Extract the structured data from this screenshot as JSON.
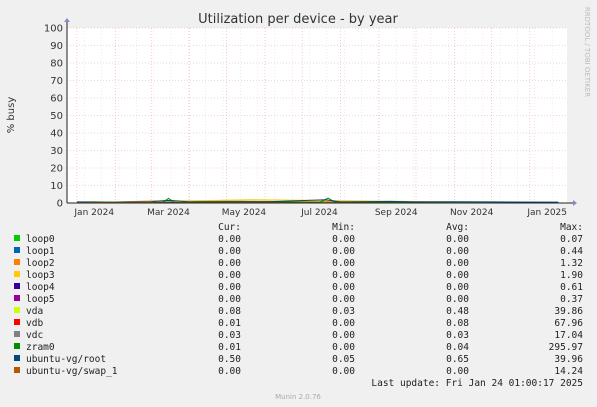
{
  "chart_data": {
    "type": "line",
    "title": "Utilization per device - by year",
    "ylabel": "% busy",
    "ylim": [
      0,
      100
    ],
    "yticks": [
      0,
      10,
      20,
      30,
      40,
      50,
      60,
      70,
      80,
      90,
      100
    ],
    "xlim": [
      "2023-12-24",
      "2025-01-31"
    ],
    "xticks": [
      {
        "label": "Jan 2024",
        "date": "2024-01-15"
      },
      {
        "label": "Mar 2024",
        "date": "2024-03-15"
      },
      {
        "label": "May 2024",
        "date": "2024-05-15"
      },
      {
        "label": "Jul 2024",
        "date": "2024-07-15"
      },
      {
        "label": "Sep 2024",
        "date": "2024-09-15"
      },
      {
        "label": "Nov 2024",
        "date": "2024-11-15"
      },
      {
        "label": "Jan 2025",
        "date": "2025-01-15"
      }
    ],
    "grid": true,
    "watermark": "RRDTOOL / TOBI OETIKER",
    "series": [
      {
        "name": "loop0",
        "color": "#00cc00",
        "values": [
          {
            "x": "2024-01-01",
            "y": 0.0
          },
          {
            "x": "2024-06-01",
            "y": 0.07
          },
          {
            "x": "2025-01-24",
            "y": 0.0
          }
        ]
      },
      {
        "name": "loop1",
        "color": "#0066b3",
        "values": [
          {
            "x": "2024-01-01",
            "y": 0.0
          },
          {
            "x": "2024-06-01",
            "y": 0.44
          },
          {
            "x": "2025-01-24",
            "y": 0.0
          }
        ]
      },
      {
        "name": "loop2",
        "color": "#ff8000",
        "values": [
          {
            "x": "2024-01-01",
            "y": 0.0
          },
          {
            "x": "2024-03-10",
            "y": 1.32
          },
          {
            "x": "2025-01-24",
            "y": 0.0
          }
        ]
      },
      {
        "name": "loop3",
        "color": "#ffcc00",
        "values": [
          {
            "x": "2024-01-01",
            "y": 0.0
          },
          {
            "x": "2024-05-20",
            "y": 1.9
          },
          {
            "x": "2025-01-24",
            "y": 0.0
          }
        ]
      },
      {
        "name": "loop4",
        "color": "#330099",
        "values": [
          {
            "x": "2024-01-01",
            "y": 0.0
          },
          {
            "x": "2024-04-10",
            "y": 0.61
          },
          {
            "x": "2025-01-24",
            "y": 0.0
          }
        ]
      },
      {
        "name": "loop5",
        "color": "#990099",
        "values": [
          {
            "x": "2024-01-01",
            "y": 0.0
          },
          {
            "x": "2024-08-01",
            "y": 0.37
          },
          {
            "x": "2025-01-24",
            "y": 0.0
          }
        ]
      },
      {
        "name": "vda",
        "color": "#ccff00",
        "values": [
          {
            "x": "2024-01-01",
            "y": 0.5
          },
          {
            "x": "2024-01-15",
            "y": 0.8
          },
          {
            "x": "2024-02-01",
            "y": 0.4
          },
          {
            "x": "2024-03-01",
            "y": 0.6
          },
          {
            "x": "2024-03-15",
            "y": 1.2
          },
          {
            "x": "2024-04-01",
            "y": 0.5
          },
          {
            "x": "2024-05-01",
            "y": 0.7
          },
          {
            "x": "2024-06-01",
            "y": 0.5
          },
          {
            "x": "2024-07-01",
            "y": 0.4
          },
          {
            "x": "2024-08-01",
            "y": 0.3
          },
          {
            "x": "2024-09-01",
            "y": 0.4
          },
          {
            "x": "2024-10-01",
            "y": 0.3
          },
          {
            "x": "2024-11-01",
            "y": 0.4
          },
          {
            "x": "2024-12-01",
            "y": 0.3
          },
          {
            "x": "2025-01-24",
            "y": 0.08
          }
        ]
      },
      {
        "name": "vdb",
        "color": "#ff0000",
        "values": [
          {
            "x": "2024-01-01",
            "y": 0.0
          },
          {
            "x": "2024-07-01",
            "y": 0.1
          },
          {
            "x": "2025-01-24",
            "y": 0.01
          }
        ]
      },
      {
        "name": "vdc",
        "color": "#808080",
        "values": [
          {
            "x": "2024-01-01",
            "y": 0.0
          },
          {
            "x": "2024-06-01",
            "y": 0.1
          },
          {
            "x": "2025-01-24",
            "y": 0.03
          }
        ]
      },
      {
        "name": "zram0",
        "color": "#008f00",
        "values": [
          {
            "x": "2024-01-01",
            "y": 0.0
          },
          {
            "x": "2024-03-10",
            "y": 0.2
          },
          {
            "x": "2024-03-15",
            "y": 2.6
          },
          {
            "x": "2024-03-20",
            "y": 0.2
          },
          {
            "x": "2024-05-20",
            "y": 0.8
          },
          {
            "x": "2024-07-15",
            "y": 0.3
          },
          {
            "x": "2024-07-22",
            "y": 2.8
          },
          {
            "x": "2024-07-28",
            "y": 0.2
          },
          {
            "x": "2024-09-10",
            "y": 0.5
          },
          {
            "x": "2024-10-15",
            "y": 0.1
          },
          {
            "x": "2025-01-24",
            "y": 0.01
          }
        ]
      },
      {
        "name": "ubuntu-vg/root",
        "color": "#00487d",
        "values": [
          {
            "x": "2024-01-01",
            "y": 0.6
          },
          {
            "x": "2024-02-01",
            "y": 0.5
          },
          {
            "x": "2024-03-01",
            "y": 0.7
          },
          {
            "x": "2024-03-15",
            "y": 1.5
          },
          {
            "x": "2024-04-01",
            "y": 0.6
          },
          {
            "x": "2024-05-01",
            "y": 0.8
          },
          {
            "x": "2024-06-01",
            "y": 0.6
          },
          {
            "x": "2024-07-20",
            "y": 1.8
          },
          {
            "x": "2024-08-01",
            "y": 0.6
          },
          {
            "x": "2024-09-10",
            "y": 0.9
          },
          {
            "x": "2024-10-01",
            "y": 0.6
          },
          {
            "x": "2024-11-01",
            "y": 0.7
          },
          {
            "x": "2024-12-01",
            "y": 0.6
          },
          {
            "x": "2025-01-24",
            "y": 0.5
          }
        ]
      },
      {
        "name": "ubuntu-vg/swap_1",
        "color": "#b35a00",
        "values": [
          {
            "x": "2024-01-01",
            "y": 0.0
          },
          {
            "x": "2024-01-20",
            "y": 0.3
          },
          {
            "x": "2024-03-15",
            "y": 0.2
          },
          {
            "x": "2025-01-24",
            "y": 0.0
          }
        ]
      }
    ]
  },
  "legend": {
    "headers": {
      "cur": "Cur:",
      "min": "Min:",
      "avg": "Avg:",
      "max": "Max:"
    },
    "rows": [
      {
        "name": "loop0",
        "color": "#00cc00",
        "cur": "0.00",
        "min": "0.00",
        "avg": "0.00",
        "max": "0.07"
      },
      {
        "name": "loop1",
        "color": "#0066b3",
        "cur": "0.00",
        "min": "0.00",
        "avg": "0.00",
        "max": "0.44"
      },
      {
        "name": "loop2",
        "color": "#ff8000",
        "cur": "0.00",
        "min": "0.00",
        "avg": "0.00",
        "max": "1.32"
      },
      {
        "name": "loop3",
        "color": "#ffcc00",
        "cur": "0.00",
        "min": "0.00",
        "avg": "0.00",
        "max": "1.90"
      },
      {
        "name": "loop4",
        "color": "#330099",
        "cur": "0.00",
        "min": "0.00",
        "avg": "0.00",
        "max": "0.61"
      },
      {
        "name": "loop5",
        "color": "#990099",
        "cur": "0.00",
        "min": "0.00",
        "avg": "0.00",
        "max": "0.37"
      },
      {
        "name": "vda",
        "color": "#ccff00",
        "cur": "0.08",
        "min": "0.03",
        "avg": "0.48",
        "max": "39.86"
      },
      {
        "name": "vdb",
        "color": "#ff0000",
        "cur": "0.01",
        "min": "0.00",
        "avg": "0.08",
        "max": "67.96"
      },
      {
        "name": "vdc",
        "color": "#808080",
        "cur": "0.03",
        "min": "0.00",
        "avg": "0.03",
        "max": "17.04"
      },
      {
        "name": "zram0",
        "color": "#008f00",
        "cur": "0.01",
        "min": "0.00",
        "avg": "0.04",
        "max": "295.97"
      },
      {
        "name": "ubuntu-vg/root",
        "color": "#00487d",
        "cur": "0.50",
        "min": "0.05",
        "avg": "0.65",
        "max": "39.96"
      },
      {
        "name": "ubuntu-vg/swap_1",
        "color": "#b35a00",
        "cur": "0.00",
        "min": "0.00",
        "avg": "0.00",
        "max": "14.24"
      }
    ],
    "last_update": "Last update: Fri Jan 24 01:00:17 2025"
  },
  "footer": {
    "generator": "Munin 2.0.76"
  }
}
